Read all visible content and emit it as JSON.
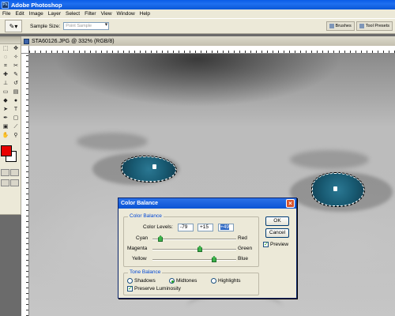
{
  "app": {
    "title": "Adobe Photoshop"
  },
  "menu": [
    "File",
    "Edit",
    "Image",
    "Layer",
    "Select",
    "Filter",
    "View",
    "Window",
    "Help"
  ],
  "options_bar": {
    "tool_icon": "eyedropper-icon",
    "sample_size_label": "Sample Size:",
    "sample_size_value": "Point Sample",
    "palette_tabs": [
      "Brushes",
      "Tool Presets"
    ]
  },
  "document": {
    "title": "STA60126.JPG @ 332% (RGB/8)"
  },
  "toolbox": {
    "foreground_color": "#e80000",
    "background_color": "#ffffff"
  },
  "dialog": {
    "title": "Color Balance",
    "color_balance_group": "Color Balance",
    "color_levels_label": "Color Levels:",
    "levels": [
      "-79",
      "+15",
      "+49"
    ],
    "sliders": [
      {
        "left": "Cyan",
        "right": "Red",
        "value": -79
      },
      {
        "left": "Magenta",
        "right": "Green",
        "value": 15
      },
      {
        "left": "Yellow",
        "right": "Blue",
        "value": 49
      }
    ],
    "tone_balance_group": "Tone Balance",
    "tones": [
      "Shadows",
      "Midtones",
      "Highlights"
    ],
    "selected_tone": "Midtones",
    "preserve_luminosity_label": "Preserve Luminosity",
    "preserve_luminosity_checked": true,
    "ok_label": "OK",
    "cancel_label": "Cancel",
    "preview_label": "Preview",
    "preview_checked": true
  }
}
